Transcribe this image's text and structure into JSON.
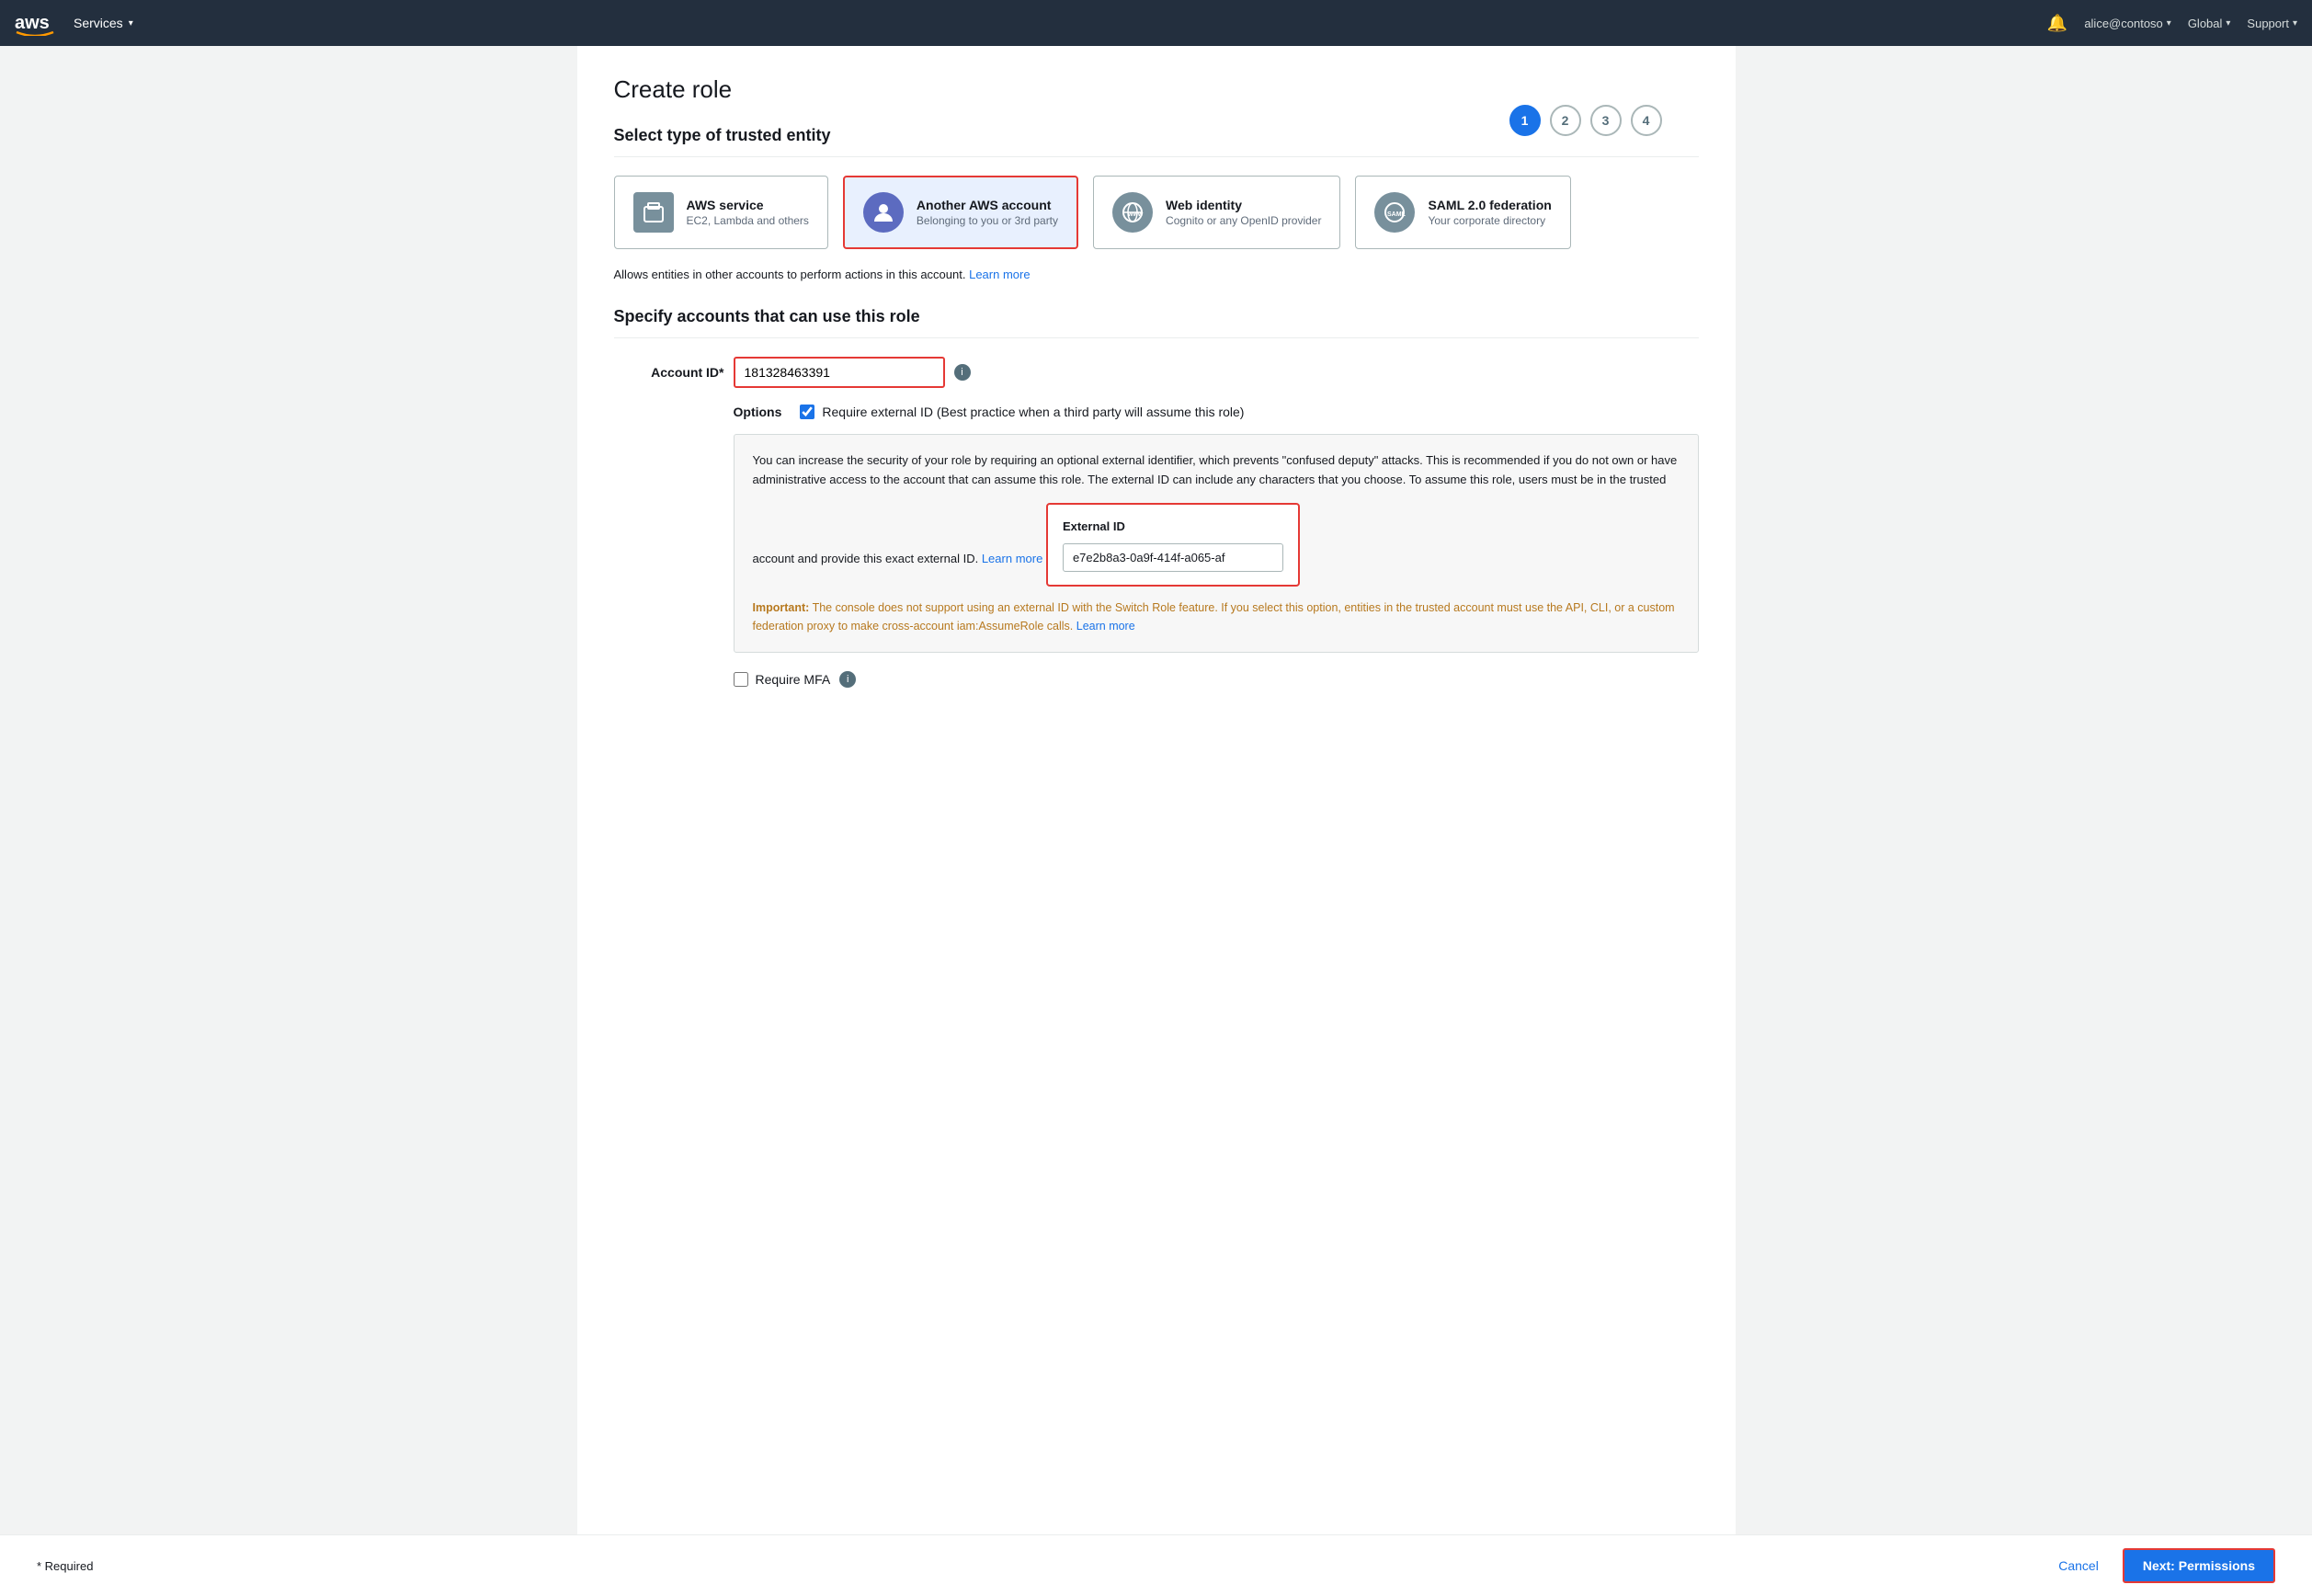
{
  "nav": {
    "logo_text": "aws",
    "services_label": "Services",
    "bell_title": "Notifications",
    "user_label": "alice@contoso",
    "region_label": "Global",
    "support_label": "Support"
  },
  "wizard": {
    "steps": [
      {
        "number": "1",
        "active": true
      },
      {
        "number": "2",
        "active": false
      },
      {
        "number": "3",
        "active": false
      },
      {
        "number": "4",
        "active": false
      }
    ]
  },
  "page": {
    "title": "Create role",
    "section1_title": "Select type of trusted entity",
    "entity_cards": [
      {
        "id": "aws-service",
        "icon_type": "box",
        "title": "AWS service",
        "subtitle": "EC2, Lambda and others",
        "selected": false
      },
      {
        "id": "another-aws-account",
        "icon_type": "person",
        "title": "Another AWS account",
        "subtitle": "Belonging to you or 3rd party",
        "selected": true
      },
      {
        "id": "web-identity",
        "icon_type": "web",
        "title": "Web identity",
        "subtitle": "Cognito or any OpenID provider",
        "selected": false
      },
      {
        "id": "saml-federation",
        "icon_type": "saml",
        "title": "SAML 2.0 federation",
        "subtitle": "Your corporate directory",
        "selected": false
      }
    ],
    "account_info_text": "Allows entities in other accounts to perform actions in this account.",
    "account_info_link": "Learn more",
    "section2_title": "Specify accounts that can use this role",
    "account_id_label": "Account ID*",
    "account_id_value": "181328463391",
    "account_id_placeholder": "",
    "options_label": "Options",
    "require_external_id_label": "Require external ID (Best practice when a third party will assume this role)",
    "require_external_id_checked": true,
    "info_box_text": "You can increase the security of your role by requiring an optional external identifier, which prevents \"confused deputy\" attacks. This is recommended if you do not own or have administrative access to the account that can assume this role. The external ID can include any characters that you choose. To assume this role, users must be in the trusted account and provide this exact external ID.",
    "info_box_link_text": "Learn more",
    "external_id_label": "External ID",
    "external_id_value": "e7e2b8a3-0a9f-414f-a065-af",
    "important_prefix": "Important:",
    "important_text": " The console does not support using an external ID with the Switch Role feature. If you select this option, entities in the trusted account must use the API, CLI, or a custom federation proxy to make cross-account iam:AssumeRole calls.",
    "important_link_text": "Learn more",
    "require_mfa_label": "Require MFA",
    "require_mfa_checked": false,
    "required_note": "* Required",
    "cancel_label": "Cancel",
    "next_label": "Next: Permissions"
  }
}
